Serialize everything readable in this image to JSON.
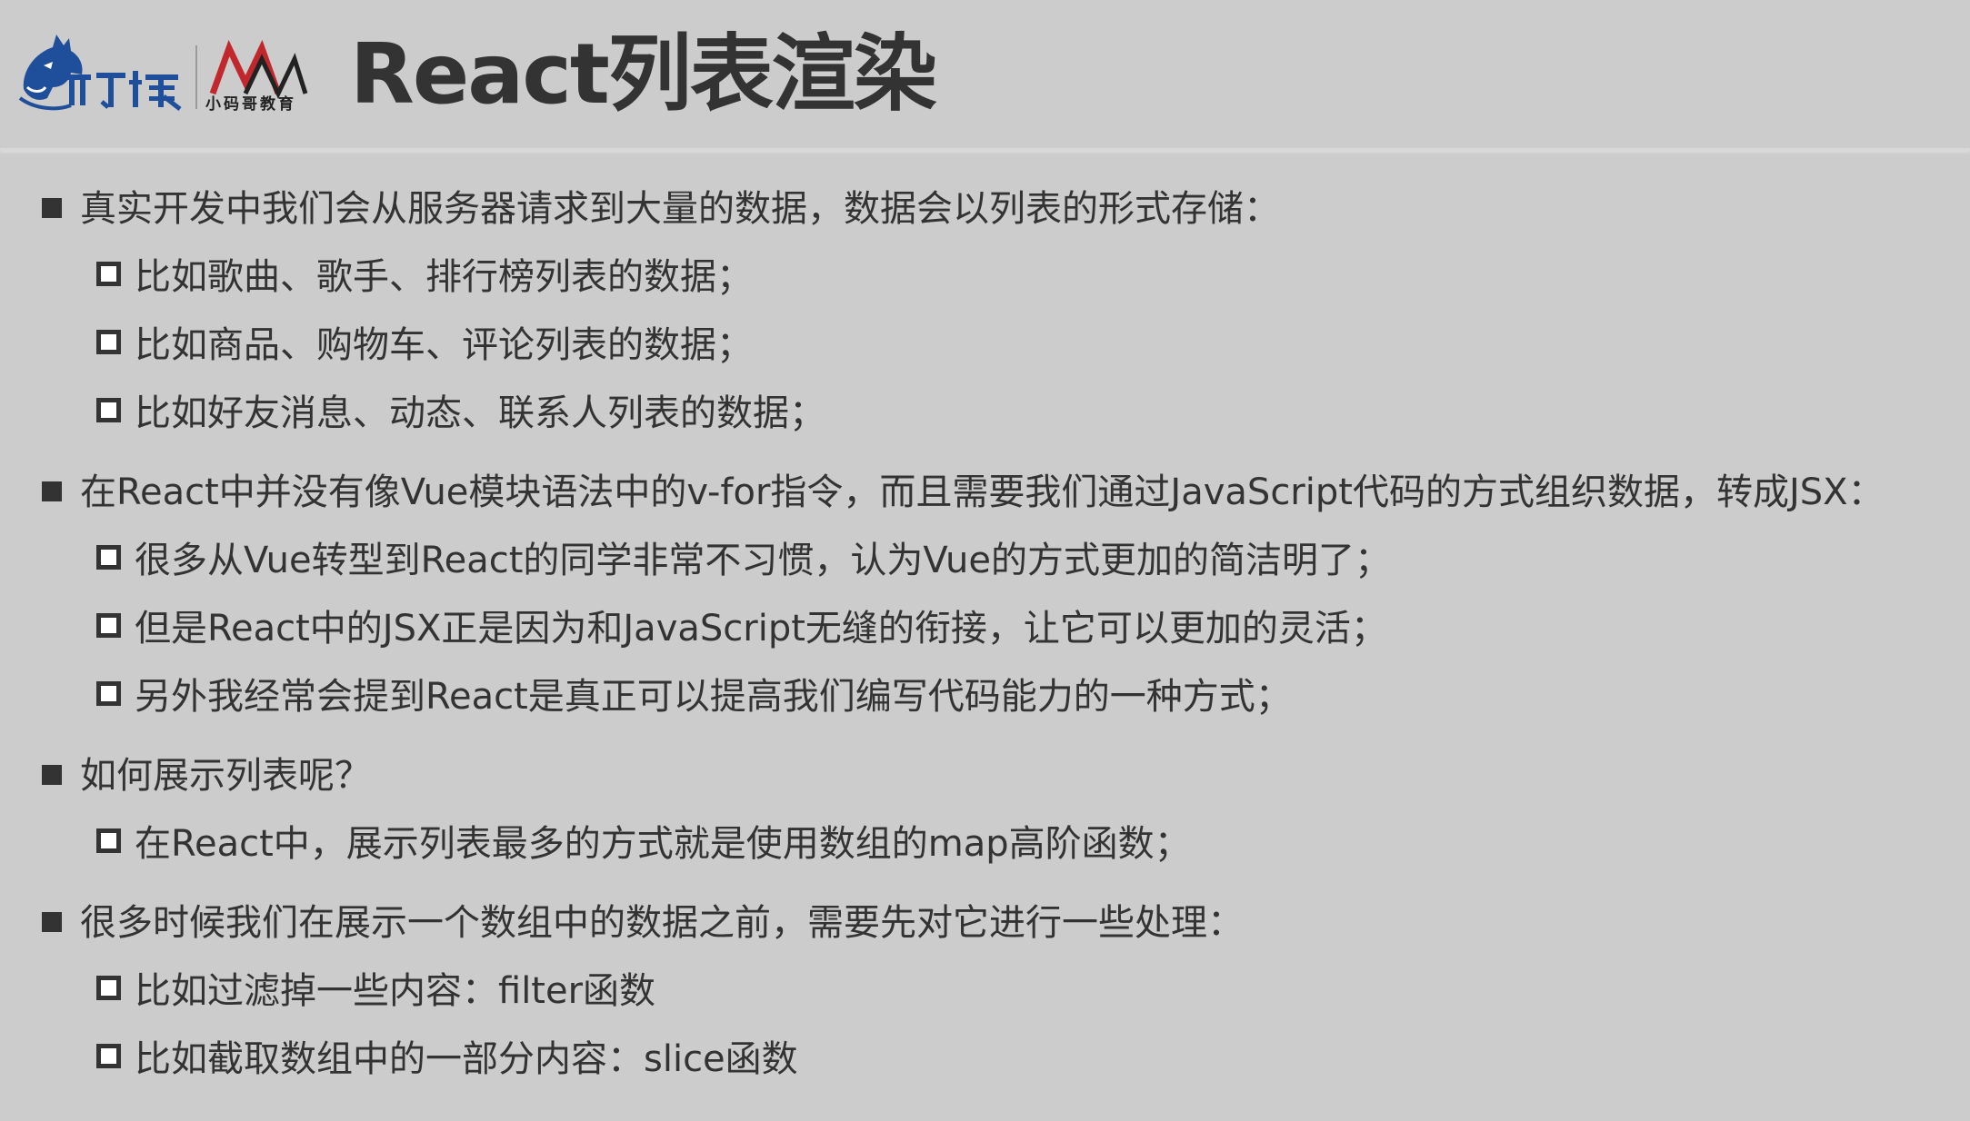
{
  "header": {
    "title": "React列表渲染",
    "logo_left_text": "邱丁狼",
    "logo_right_text": "小码哥教育"
  },
  "items": [
    {
      "text": "真实开发中我们会从服务器请求到大量的数据，数据会以列表的形式存储：",
      "sub": [
        "比如歌曲、歌手、排行榜列表的数据；",
        "比如商品、购物车、评论列表的数据；",
        "比如好友消息、动态、联系人列表的数据；"
      ]
    },
    {
      "text": "在React中并没有像Vue模块语法中的v-for指令，而且需要我们通过JavaScript代码的方式组织数据，转成JSX：",
      "sub": [
        "很多从Vue转型到React的同学非常不习惯，认为Vue的方式更加的简洁明了；",
        "但是React中的JSX正是因为和JavaScript无缝的衔接，让它可以更加的灵活；",
        "另外我经常会提到React是真正可以提高我们编写代码能力的一种方式；"
      ]
    },
    {
      "text": "如何展示列表呢？",
      "sub": [
        "在React中，展示列表最多的方式就是使用数组的map高阶函数；"
      ]
    },
    {
      "text": "很多时候我们在展示一个数组中的数据之前，需要先对它进行一些处理：",
      "sub": [
        "比如过滤掉一些内容：filter函数",
        "比如截取数组中的一部分内容：slice函数"
      ]
    }
  ],
  "colors": {
    "background": "#cccccc",
    "text": "#333333",
    "logo_blue": "#1f4e9a",
    "logo_red": "#c0282d"
  },
  "icons": {
    "level1_bullet": "filled-square-bullet-icon",
    "level2_bullet": "hollow-square-bullet-icon",
    "logo_left": "wolf-logo-icon",
    "logo_right": "mm-logo-icon"
  }
}
